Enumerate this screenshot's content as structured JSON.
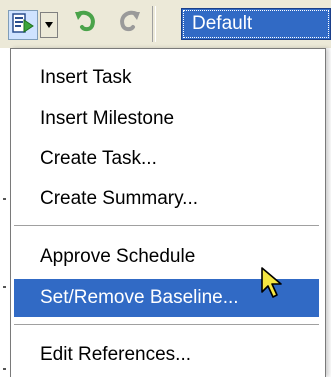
{
  "toolbar": {
    "task_icon": "task-bar-icon",
    "dropdown_icon": "chevron-down-icon",
    "undo_icon": "undo-icon",
    "redo_icon": "redo-icon",
    "view_select_value": "Default"
  },
  "menu": {
    "items": [
      {
        "label": "Insert Task"
      },
      {
        "label": "Insert Milestone"
      },
      {
        "label": "Create Task..."
      },
      {
        "label": "Create Summary..."
      },
      {
        "label": "Approve Schedule"
      },
      {
        "label": "Set/Remove Baseline...",
        "selected": true
      },
      {
        "label": "Edit References..."
      }
    ]
  },
  "colors": {
    "selection": "#316ac5",
    "toolbar_bg": "#ece9d8",
    "undo_green": "#4aa34a",
    "redo_gray": "#9a9a9a"
  }
}
